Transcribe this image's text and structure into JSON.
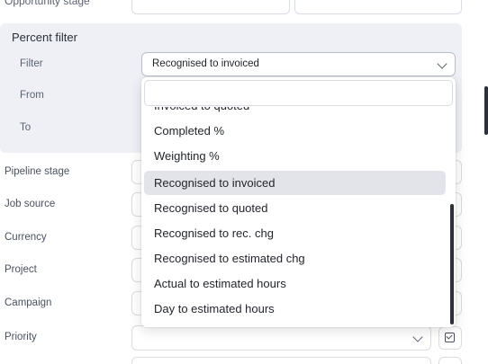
{
  "top_row": {
    "label": "Opportunity stage"
  },
  "percent_filter": {
    "title": "Percent filter",
    "filter_label": "Filter",
    "filter_value": "Recognised to invoiced",
    "from_label": "From",
    "to_label": "To"
  },
  "fields": {
    "pipeline_stage": "Pipeline stage",
    "job_source": "Job source",
    "currency": "Currency",
    "project": "Project",
    "campaign": "Campaign",
    "priority": "Priority"
  },
  "dropdown": {
    "search_placeholder": "",
    "items": [
      "Invoiced to quoted",
      "Completed %",
      "Weighting %",
      "Recognised to invoiced",
      "Recognised to quoted",
      "Recognised to rec. chg",
      "Recognised to estimated chg",
      "Actual to estimated hours",
      "Day to estimated hours"
    ],
    "selected_index": 3
  },
  "icons": {
    "chevron": "chevron-down-icon",
    "calendar_check": "calendar-check-icon"
  },
  "colors": {
    "panel_bg": "#eef0f6",
    "selected_item_bg": "#e3e4ea",
    "text": "#1f2329",
    "label": "#5b6270"
  }
}
